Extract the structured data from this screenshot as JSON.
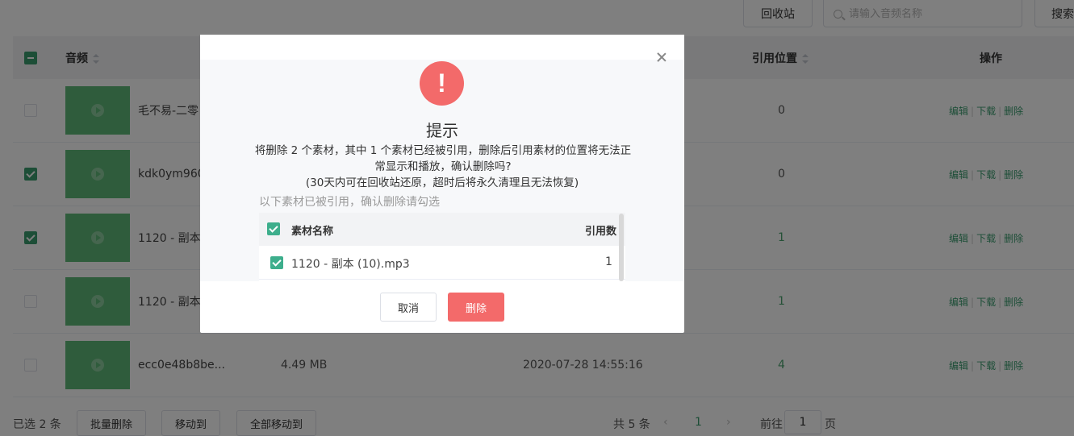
{
  "toolbar": {
    "recycle_label": "回收站",
    "search_placeholder": "请输入音频名称",
    "search_label": "搜索"
  },
  "table": {
    "headers": {
      "audio": "音频",
      "ref_position": "引用位置",
      "operations": "操作"
    },
    "rows": [
      {
        "name": "毛不易-二零",
        "size": "",
        "date": "",
        "ref": "0",
        "checked": false
      },
      {
        "name": "kdk0ym960",
        "size": "",
        "date": "",
        "ref": "0",
        "checked": true
      },
      {
        "name": "1120 - 副本",
        "size": "",
        "date": "",
        "ref": "1",
        "checked": true
      },
      {
        "name": "1120 - 副本",
        "size": "",
        "date": "",
        "ref": "1",
        "checked": false
      },
      {
        "name": "ecc0e48b8be...",
        "size": "4.49 MB",
        "date": "2020-07-28 14:55:16",
        "ref": "4",
        "checked": false
      }
    ],
    "ops": {
      "edit": "编辑",
      "download": "下载",
      "delete": "删除",
      "sep": "|"
    }
  },
  "footer": {
    "selected": "已选 2 条",
    "batch_delete": "批量删除",
    "move_to": "移动到",
    "move_all_to": "全部移动到",
    "total": "共 5 条",
    "prev": "‹",
    "next": "›",
    "current_page": "1",
    "goto_prefix": "前往",
    "goto_value": "1",
    "goto_suffix": "页"
  },
  "dialog": {
    "icon": "!",
    "title": "提示",
    "message": "将删除 2 个素材，其中 1 个素材已经被引用，删除后引用素材的位置将无法正常显示和播放，确认删除吗?",
    "note": "(30天内可在回收站还原，超时后将永久清理且无法恢复)",
    "sub": "以下素材已被引用，确认删除请勾选",
    "inner_headers": {
      "name": "素材名称",
      "count": "引用数"
    },
    "inner_rows": [
      {
        "name": "1120 - 副本 (10).mp3",
        "count": "1"
      }
    ],
    "cancel_label": "取消",
    "delete_label": "删除"
  },
  "colors": {
    "accent": "#3a9c6f",
    "danger": "#f36a6a",
    "thumb": "#5fb878"
  }
}
